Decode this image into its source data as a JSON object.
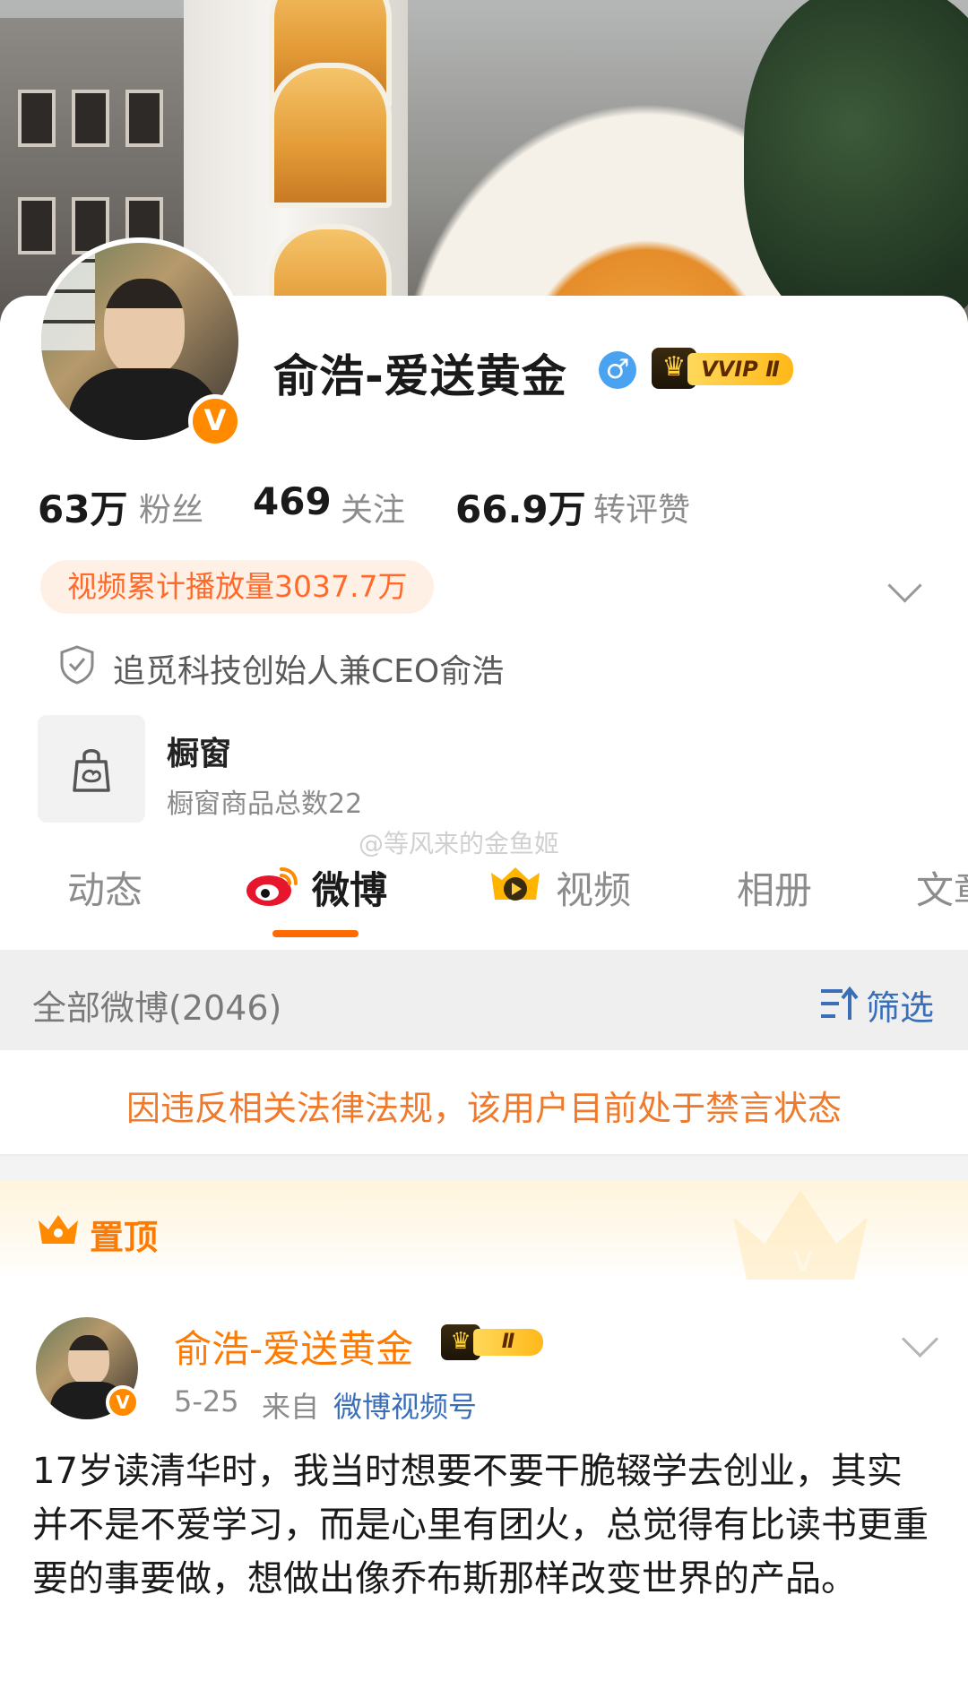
{
  "profile": {
    "name": "俞浩-爱送黄金",
    "gender_symbol": "♂",
    "vip_label": "VVIP Ⅱ",
    "verified_badge": "V",
    "stats": [
      {
        "value": "63万",
        "label": "粉丝"
      },
      {
        "value": "469",
        "label": "关注"
      },
      {
        "value": "66.9万",
        "label": "转评赞"
      }
    ],
    "video_plays": "视频累计播放量3037.7万",
    "verification": "追觅科技创始人兼CEO俞浩",
    "shop": {
      "title": "橱窗",
      "subtitle": "橱窗商品总数22"
    }
  },
  "watermark": "@等风来的金鱼姬",
  "tabs": [
    {
      "label": "动态",
      "active": false
    },
    {
      "label": "微博",
      "active": true
    },
    {
      "label": "视频",
      "active": false
    },
    {
      "label": "相册",
      "active": false
    },
    {
      "label": "文章",
      "active": false
    }
  ],
  "list_header": {
    "all_label": "全部微博(2046)",
    "filter_label": "筛选"
  },
  "ban_notice": "因违反相关法律法规，该用户目前处于禁言状态",
  "pinned": {
    "label": "置顶"
  },
  "post": {
    "author": "俞浩-爱送黄金",
    "vip_label": "Ⅱ",
    "date": "5-25",
    "from_label": "来自",
    "source": "微博视频号",
    "text": "17岁读清华时，我当时想要不要干脆辍学去创业，其实并不是不爱学习，而是心里有团火，总觉得有比读书更重要的事要做，想做出像乔布斯那样改变世界的产品。"
  },
  "colors": {
    "accent": "#ff6a00",
    "link": "#3a6fb8",
    "ban_text": "#ef7a2c",
    "pill_bg": "#fff0e6"
  },
  "icons": [
    "shield-icon",
    "shopping-bag-icon",
    "weibo-logo-icon",
    "video-play-icon",
    "filter-sort-icon",
    "crown-icon",
    "chevron-down-icon"
  ]
}
